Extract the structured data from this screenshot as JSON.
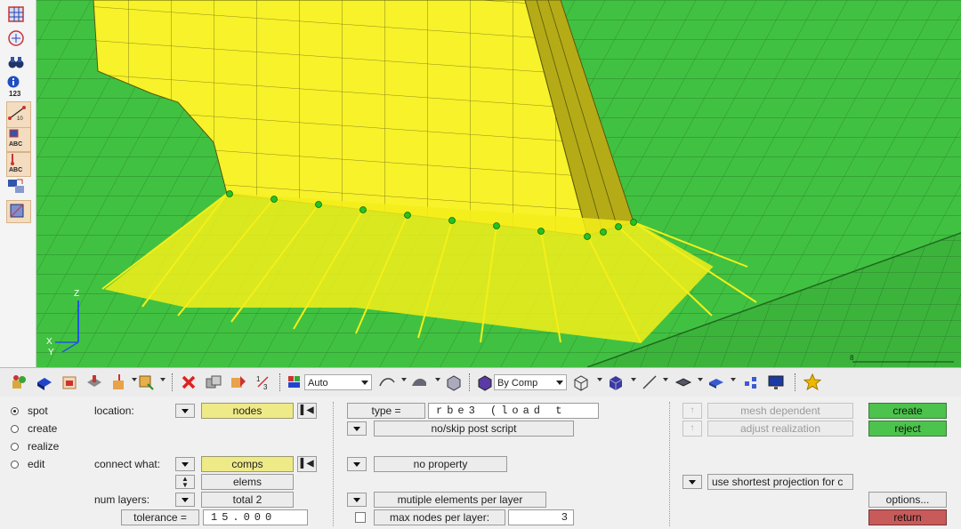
{
  "viewport": {
    "axes": {
      "z": "Z",
      "x": "X",
      "y": "Y"
    },
    "scale_label": "8"
  },
  "left_toolbar": {
    "icons": [
      "mesh-view-icon",
      "find-icon",
      "binoculars-icon",
      "info-icon",
      "measure-icon",
      "numbers-abc-icon",
      "tags-abc-icon",
      "transform-icon",
      "box-icon"
    ],
    "labels": {
      "info": "123"
    }
  },
  "toolbar": {
    "auto_label": "Auto",
    "color_mode_label": "By Comp"
  },
  "panel": {
    "modes": [
      {
        "label": "spot",
        "selected": true
      },
      {
        "label": "create",
        "selected": false
      },
      {
        "label": "realize",
        "selected": false
      },
      {
        "label": "edit",
        "selected": false
      }
    ],
    "location_label": "location:",
    "location_button": "nodes",
    "connect_label": "connect what:",
    "connect_button": "comps",
    "elems_button": "elems",
    "num_layers_label": "num layers:",
    "num_layers_button": "total 2",
    "tolerance_label": "tolerance =",
    "tolerance_value": "15.000",
    "type_label": "type =",
    "type_value": "rbe3 (load t",
    "post_script": "no/skip post script",
    "property": "no property",
    "multiple_elements": "mutiple elements per layer",
    "max_nodes_label": "max nodes per layer:",
    "max_nodes_value": "3",
    "mesh_dependent": "mesh dependent",
    "adjust_realization": "adjust realization",
    "shortest_projection": "use shortest projection for c",
    "create_button": "create",
    "reject_button": "reject",
    "options_button": "options...",
    "return_button": "return"
  }
}
